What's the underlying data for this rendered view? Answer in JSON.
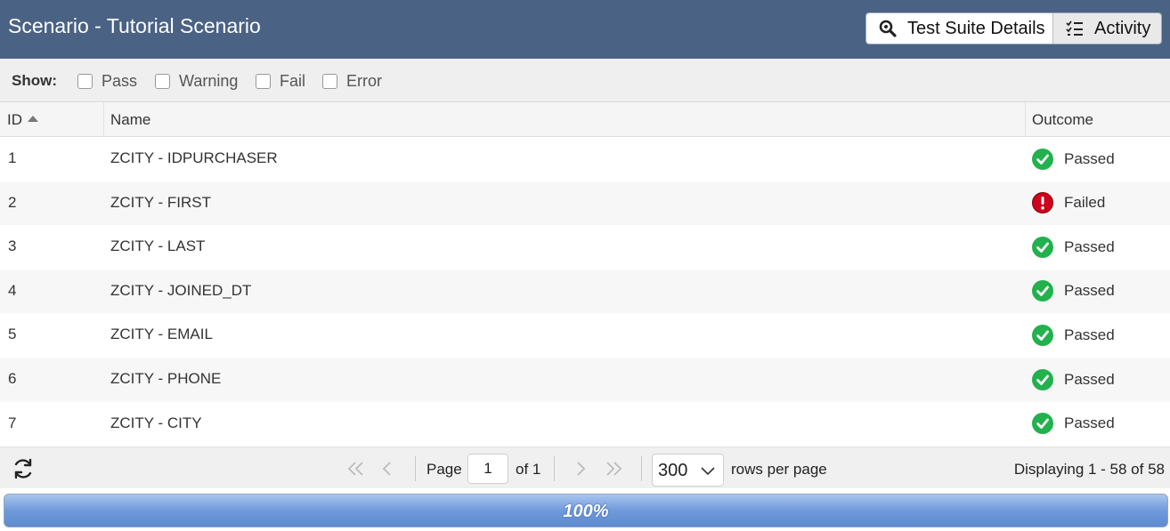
{
  "header": {
    "title": "Scenario - Tutorial Scenario",
    "buttons": {
      "details": "Test Suite Details",
      "activity": "Activity"
    }
  },
  "filters": {
    "show_label": "Show:",
    "options": [
      "Pass",
      "Warning",
      "Fail",
      "Error"
    ]
  },
  "table": {
    "columns": {
      "id": "ID",
      "name": "Name",
      "outcome": "Outcome"
    },
    "sort": "ID ascending",
    "rows": [
      {
        "id": "1",
        "name": "ZCITY - IDPURCHASER",
        "outcome": "Passed",
        "status": "pass"
      },
      {
        "id": "2",
        "name": "ZCITY - FIRST",
        "outcome": "Failed",
        "status": "fail"
      },
      {
        "id": "3",
        "name": "ZCITY - LAST",
        "outcome": "Passed",
        "status": "pass"
      },
      {
        "id": "4",
        "name": "ZCITY - JOINED_DT",
        "outcome": "Passed",
        "status": "pass"
      },
      {
        "id": "5",
        "name": "ZCITY - EMAIL",
        "outcome": "Passed",
        "status": "pass"
      },
      {
        "id": "6",
        "name": "ZCITY - PHONE",
        "outcome": "Passed",
        "status": "pass"
      },
      {
        "id": "7",
        "name": "ZCITY - CITY",
        "outcome": "Passed",
        "status": "pass"
      }
    ]
  },
  "pager": {
    "page_label": "Page",
    "page_value": "1",
    "of_label": "of 1",
    "rows_per_page_value": "300",
    "rows_per_page_label": "rows per page",
    "display_text": "Displaying 1 - 58 of 58"
  },
  "progress": {
    "text": "100%",
    "value": 1.0
  },
  "colors": {
    "header_bg": "#4a6284",
    "pass": "#22b14c",
    "fail": "#d0021b"
  },
  "icons": {
    "details": "magnifier-icon",
    "activity": "checklist-icon",
    "refresh": "refresh-icon",
    "pass": "check-circle-icon",
    "fail": "exclamation-circle-icon"
  }
}
